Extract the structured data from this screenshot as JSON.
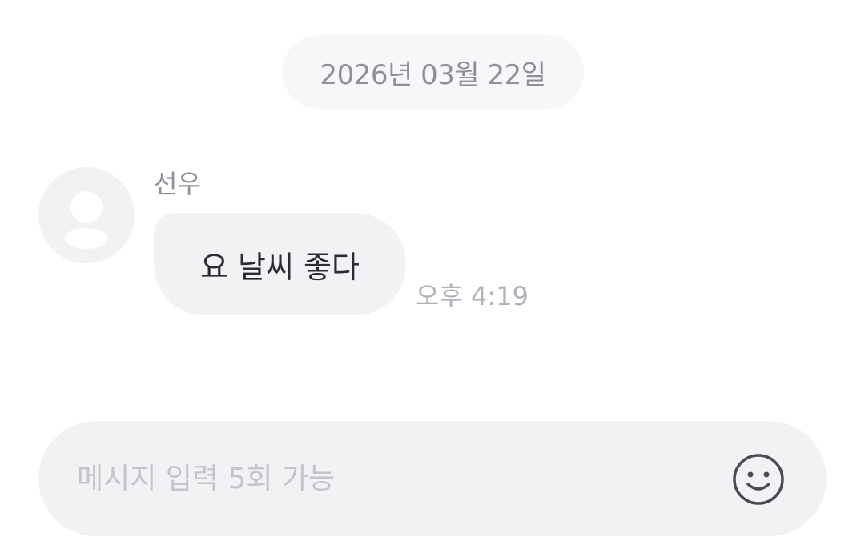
{
  "chat": {
    "date_separator": "2026년 03월 22일",
    "messages": [
      {
        "sender": "선우",
        "text": "요 날씨 좋다",
        "time": "오후 4:19"
      }
    ]
  },
  "composer": {
    "placeholder": "메시지 입력 5회 가능",
    "value": "",
    "emoji_icon": "smiley-icon"
  },
  "colors": {
    "bubble_bg": "#f2f2f4",
    "muted_text": "#8f8f98",
    "primary_text": "#2b2b33"
  }
}
